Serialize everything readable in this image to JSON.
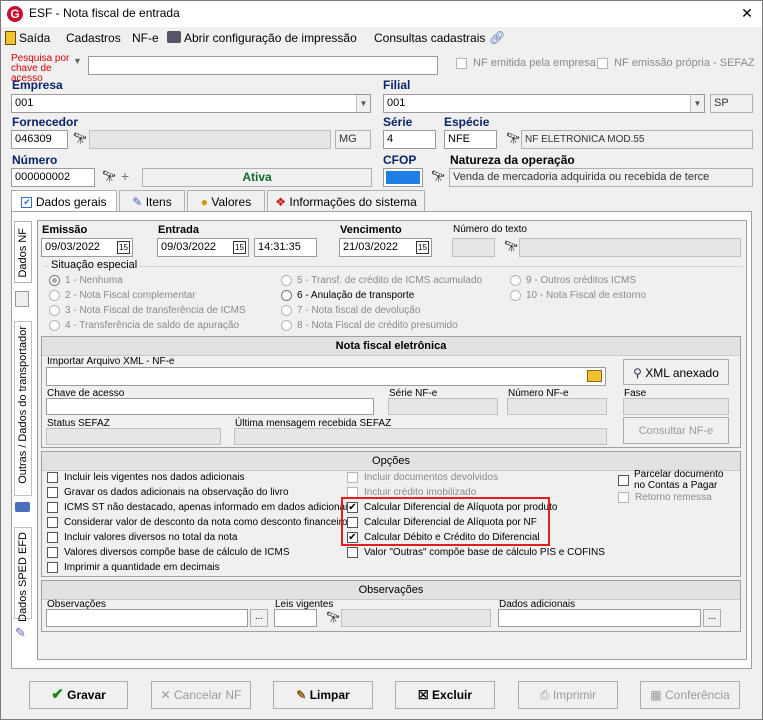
{
  "window": {
    "title": "ESF - Nota fiscal de entrada",
    "close_glyph": "✕"
  },
  "menu": {
    "saida": "Saída",
    "cadastros": "Cadastros",
    "nfe": "NF-e",
    "abrir": "Abrir configuração de impressão",
    "consultas": "Consultas cadastrais"
  },
  "search": {
    "label": "Pesquisa por chave de acesso",
    "value": "",
    "chk_emitida": "NF emitida pela empresa",
    "chk_propria": "NF emissão própria - SEFAZ"
  },
  "empresa": {
    "label": "Empresa",
    "value": "001"
  },
  "filial": {
    "label": "Filial",
    "value": "001",
    "uf": "SP"
  },
  "fornecedor": {
    "label": "Fornecedor",
    "code": "046309",
    "name": "",
    "uf": "MG"
  },
  "serie": {
    "label": "Série",
    "value": "4"
  },
  "especie": {
    "label": "Espécie",
    "code": "NFE",
    "desc": "NF ELETRONICA MOD.55"
  },
  "numero": {
    "label": "Número",
    "value": "000000002",
    "status": "Ativa"
  },
  "cfop": {
    "label": "CFOP"
  },
  "natureza": {
    "label": "Natureza da operação",
    "value": "Venda de mercadoria adquirida ou recebida de terce"
  },
  "tabs": {
    "dados_gerais": "Dados gerais",
    "itens": "Itens",
    "valores": "Valores",
    "info_sistema": "Informações do sistema"
  },
  "vtabs": {
    "dados_nf": "Dados NF",
    "outras": "Outras / Dados do transportador",
    "sped": "Dados SPED EFD"
  },
  "dates": {
    "emissao_label": "Emissão",
    "emissao": "09/03/2022",
    "entrada_label": "Entrada",
    "entrada": "09/03/2022",
    "hora": "14:31:35",
    "vencimento_label": "Vencimento",
    "vencimento": "21/03/2022",
    "num_texto_label": "Número do texto",
    "cal_glyph": "15"
  },
  "situacao": {
    "label": "Situação especial",
    "col1": [
      "1 - Nenhuma",
      "2 - Nota Fiscal complementar",
      "3 - Nota Fiscal de transferência de ICMS",
      "4 - Transferência de saldo de apuração"
    ],
    "col2": [
      "5 - Transf. de crédito de ICMS acumulado",
      "6 - Anulação de transporte",
      "7 - Nota fiscal de devolução",
      "8 - Nota Fiscal de crédito presumido"
    ],
    "col3": [
      "9 - Outros créditos ICMS",
      "10 - Nota Fiscal de estorno"
    ]
  },
  "nfe_panel": {
    "title": "Nota fiscal eletrônica",
    "importar_label": "Importar Arquivo XML - NF-e",
    "xml_button": "XML anexado",
    "chave_label": "Chave de acesso",
    "serie_label": "Série NF-e",
    "numero_label": "Número NF-e",
    "fase_label": "Fase",
    "status_label": "Status SEFAZ",
    "ultima_label": "Última mensagem recebida SEFAZ",
    "consultar_button": "Consultar NF-e"
  },
  "opcoes": {
    "title": "Opções",
    "col1": [
      {
        "label": "Incluir leis vigentes nos dados adicionais",
        "checked": false
      },
      {
        "label": "Gravar os dados adicionais na observação do livro",
        "checked": false
      },
      {
        "label": "ICMS ST não destacado, apenas informado em dados adicionais",
        "checked": false
      },
      {
        "label": "Considerar valor de desconto da nota como desconto financeiro",
        "checked": false
      },
      {
        "label": "Incluir valores diversos no total da nota",
        "checked": false
      },
      {
        "label": "Valores diversos compõe base de cálculo de ICMS",
        "checked": false
      },
      {
        "label": "Imprimir a quantidade em decimais",
        "checked": false
      }
    ],
    "col2": [
      {
        "label": "Incluir documentos devolvidos",
        "checked": false,
        "disabled": true
      },
      {
        "label": "Incluir crédito imobilizado",
        "checked": false,
        "disabled": true
      },
      {
        "label": "Calcular Diferencial de Alíquota por produto",
        "checked": true,
        "disabled": false
      },
      {
        "label": "Calcular Diferencial de Alíquota por NF",
        "checked": false,
        "disabled": false
      },
      {
        "label": "Calcular Débito e Crédito do Diferencial",
        "checked": true,
        "disabled": false
      },
      {
        "label": "Valor \"Outras\" compõe base de cálculo PIS e COFINS",
        "checked": false,
        "disabled": false
      }
    ],
    "col3": {
      "parcelar_line1": "Parcelar documento",
      "parcelar_line2": "no Contas a Pagar",
      "retorno": "Retorno remessa"
    },
    "check_glyph": "✔"
  },
  "observacoes": {
    "title": "Observações",
    "obs_label": "Observações",
    "leis_label": "Leis vigentes",
    "dados_label": "Dados adicionais",
    "ellipsis": "..."
  },
  "buttons": {
    "gravar": "Gravar",
    "cancelar": "Cancelar NF",
    "limpar": "Limpar",
    "excluir": "Excluir",
    "imprimir": "Imprimir",
    "conferencia": "Conferência"
  },
  "colors": {
    "highlight": "#e02020",
    "cfop_blue": "#1e7ee6",
    "status_green": "#0c6a2a"
  }
}
